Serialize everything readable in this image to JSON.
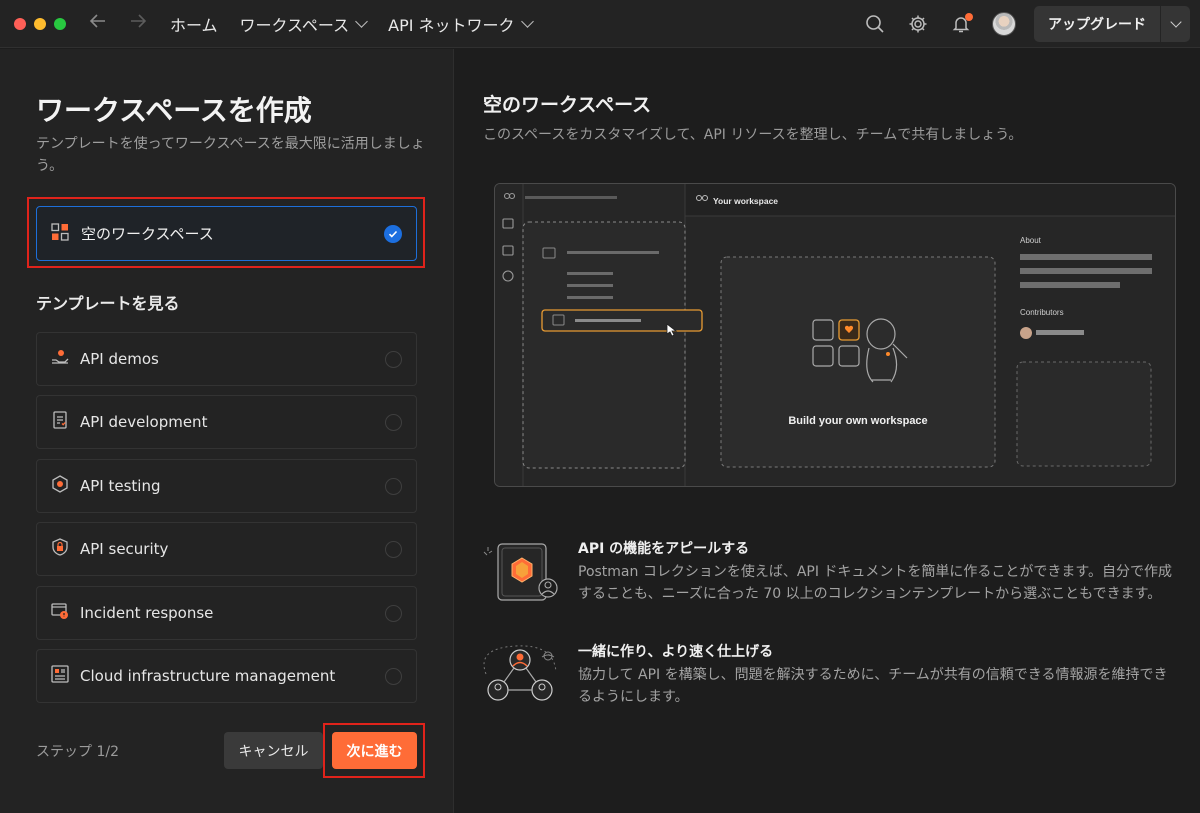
{
  "window": {
    "nav": {
      "home": "ホーム",
      "workspaces": "ワークスペース",
      "api_network": "API ネットワーク"
    },
    "upgrade_label": "アップグレード",
    "icons": [
      "back-arrow-icon",
      "forward-arrow-icon",
      "search-icon",
      "gear-icon",
      "bell-icon",
      "avatar",
      "chevron-down-icon"
    ]
  },
  "left": {
    "title": "ワークスペースを作成",
    "subtitle": "テンプレートを使ってワークスペースを最大限に活用しましょう。",
    "selected_option": "空のワークスペース",
    "templates_heading": "テンプレートを見る",
    "templates": [
      {
        "label": "API demos",
        "icon": "hand-coin-icon"
      },
      {
        "label": "API development",
        "icon": "checklist-icon"
      },
      {
        "label": "API testing",
        "icon": "hexagon-gear-icon"
      },
      {
        "label": "API security",
        "icon": "shield-lock-icon"
      },
      {
        "label": "Incident response",
        "icon": "alert-window-icon"
      },
      {
        "label": "Cloud infrastructure management",
        "icon": "server-rack-icon"
      }
    ],
    "step_text": "ステップ 1/2",
    "cancel_label": "キャンセル",
    "next_label": "次に進む"
  },
  "right": {
    "title": "空のワークスペース",
    "subtitle": "このスペースをカスタマイズして、API リソースを整理し、チームで共有しましょう。",
    "preview": {
      "workspace_label": "Your workspace",
      "center_label": "Build your own workspace",
      "about_label": "About",
      "contributors_label": "Contributors"
    },
    "features": [
      {
        "title": "API の機能をアピールする",
        "desc": "Postman コレクションを使えば、API ドキュメントを簡単に作ることができます。自分で作成することも、ニーズに合った 70 以上のコレクションテンプレートから選ぶこともできます。"
      },
      {
        "title": "一緒に作り、より速く仕上げる",
        "desc": "協力して API を構築し、問題を解決するために、チームが共有の信頼できる情報源を維持できるようにします。"
      }
    ]
  },
  "colors": {
    "accent": "#ff6c37",
    "selected": "#1c6fe0",
    "highlight": "#e0231b"
  }
}
